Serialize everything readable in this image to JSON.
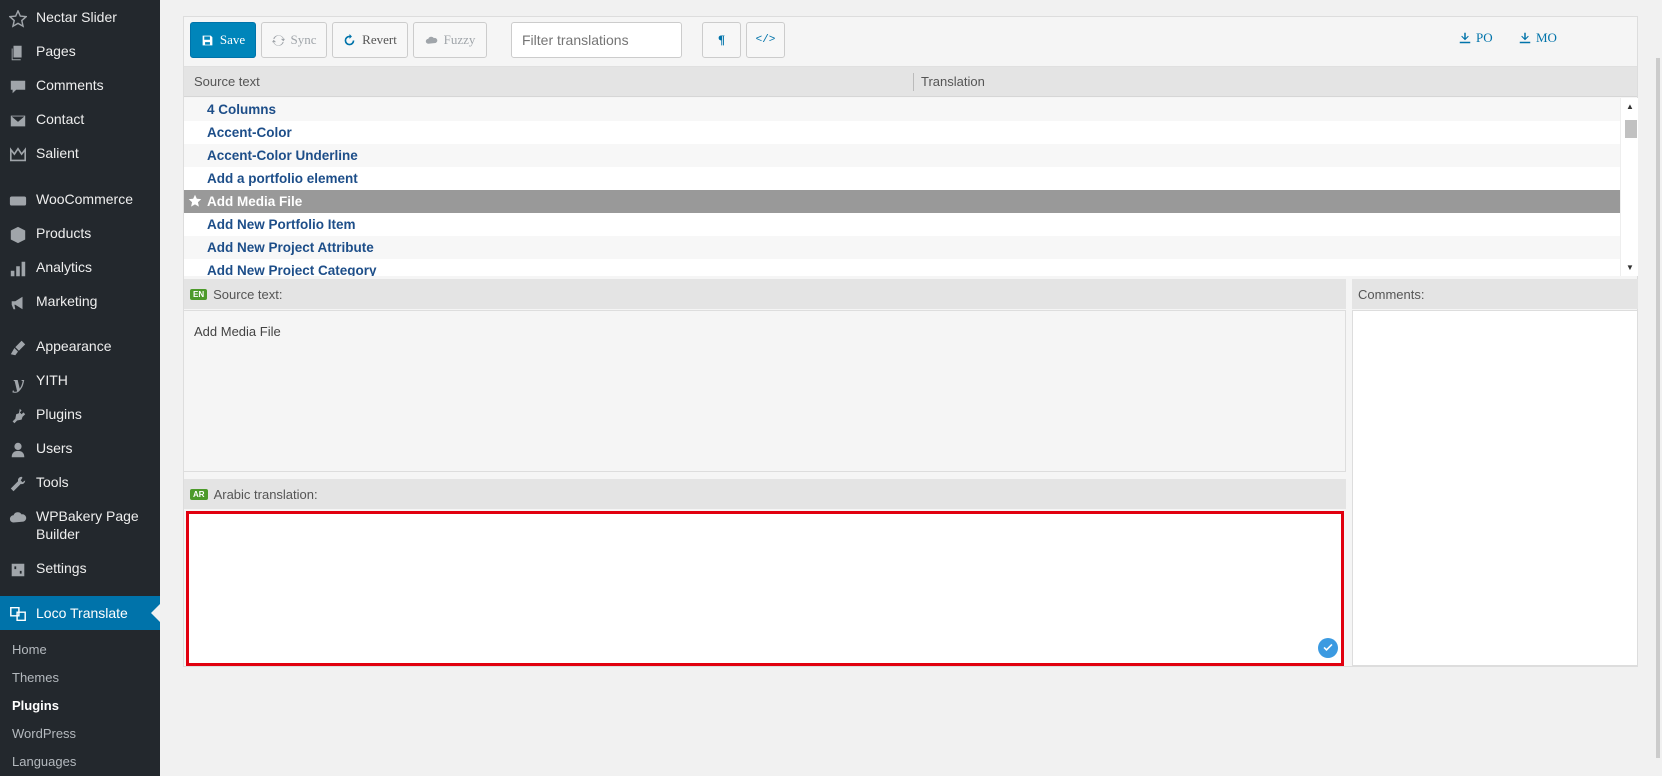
{
  "sidebar": {
    "items": [
      {
        "label": "Nectar Slider",
        "icon": "star-icon"
      },
      {
        "label": "Pages",
        "icon": "pages-icon"
      },
      {
        "label": "Comments",
        "icon": "comments-icon"
      },
      {
        "label": "Contact",
        "icon": "mail-icon"
      },
      {
        "label": "Salient",
        "icon": "crown-icon"
      },
      {
        "label": "WooCommerce",
        "icon": "woo-icon"
      },
      {
        "label": "Products",
        "icon": "box-icon"
      },
      {
        "label": "Analytics",
        "icon": "bar-chart-icon"
      },
      {
        "label": "Marketing",
        "icon": "megaphone-icon"
      },
      {
        "label": "Appearance",
        "icon": "brush-icon"
      },
      {
        "label": "YITH",
        "icon": "yith-icon"
      },
      {
        "label": "Plugins",
        "icon": "plug-icon"
      },
      {
        "label": "Users",
        "icon": "user-icon"
      },
      {
        "label": "Tools",
        "icon": "wrench-icon"
      },
      {
        "label": "WPBakery Page",
        "label2": "Builder",
        "icon": "cloud-icon"
      },
      {
        "label": "Settings",
        "icon": "settings-icon"
      },
      {
        "label": "Loco Translate",
        "icon": "translate-icon"
      }
    ],
    "submenu": [
      "Home",
      "Themes",
      "Plugins",
      "WordPress",
      "Languages"
    ]
  },
  "toolbar": {
    "save": "Save",
    "sync": "Sync",
    "revert": "Revert",
    "fuzzy": "Fuzzy",
    "filter_placeholder": "Filter translations",
    "pilcrow": "¶",
    "code": "</>",
    "po": "PO",
    "mo": "MO"
  },
  "grid": {
    "source_header": "Source text",
    "translation_header": "Translation",
    "rows": [
      "4 Columns",
      "Accent-Color",
      "Accent-Color Underline",
      "Add a portfolio element",
      "Add Media File",
      "Add New Portfolio Item",
      "Add New Project Attribute",
      "Add New Project Category"
    ],
    "selected_index": 4
  },
  "source_panel": {
    "lang": "EN",
    "label": "Source text:",
    "text": "Add Media File"
  },
  "translation_panel": {
    "lang": "AR",
    "label": "Arabic translation:"
  },
  "comments_panel": {
    "label": "Comments:"
  },
  "colors": {
    "sidebar_bg": "#23282d",
    "active_bg": "#0073aa",
    "primary_button": "#0085ba",
    "row_text": "#1d4e89",
    "selected_row": "#999999",
    "highlight_border": "#e1000f"
  }
}
